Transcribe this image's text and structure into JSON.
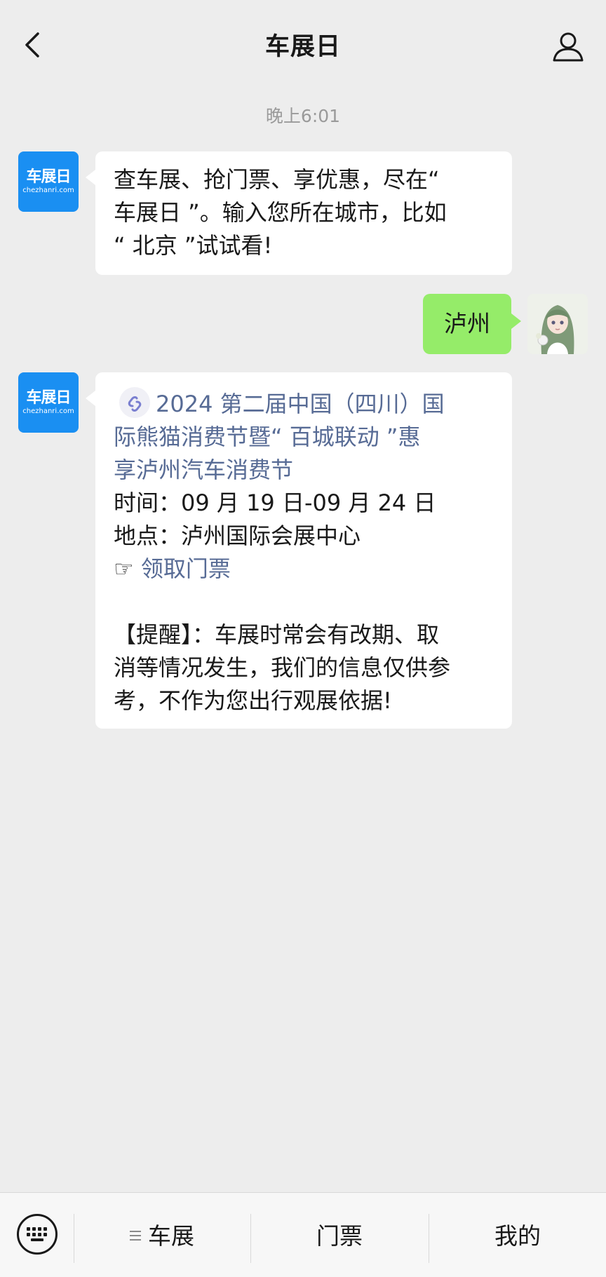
{
  "header": {
    "title": "车展日"
  },
  "timestamp": "晚上6:01",
  "bot": {
    "logo_main": "车展日",
    "logo_sub": "chezhanri.com"
  },
  "messages": {
    "welcome_lines": [
      "查车展、抢门票、享优惠，尽在“",
      "车展日 ”。输入您所在城市，比如",
      "“ 北京 ”试试看!"
    ],
    "user_reply": "泸州",
    "event": {
      "title_lines": [
        "2024 第二届中国（四川）国",
        "际熊猫消费节暨“ 百城联动 ”惠",
        "享泸州汽车消费节"
      ],
      "time_line": "时间：09 月 19 日-09 月 24 日",
      "place_line": "地点：泸州国际会展中心",
      "ticket_prefix": "☞",
      "ticket_link": "领取门票",
      "notice_lines": [
        "【提醒】：车展时常会有改期、取",
        "消等情况发生，我们的信息仅供参",
        "考，不作为您出行观展依据!"
      ]
    }
  },
  "menu": {
    "items": [
      "车展",
      "门票",
      "我的"
    ]
  },
  "colors": {
    "background": "#ededed",
    "user_bubble": "#95ec69",
    "link": "#576b95",
    "brand": "#1a8ff2"
  },
  "icons": [
    "back-arrow-icon",
    "user-profile-icon",
    "link-icon",
    "keyboard-icon",
    "menu-list-icon"
  ]
}
